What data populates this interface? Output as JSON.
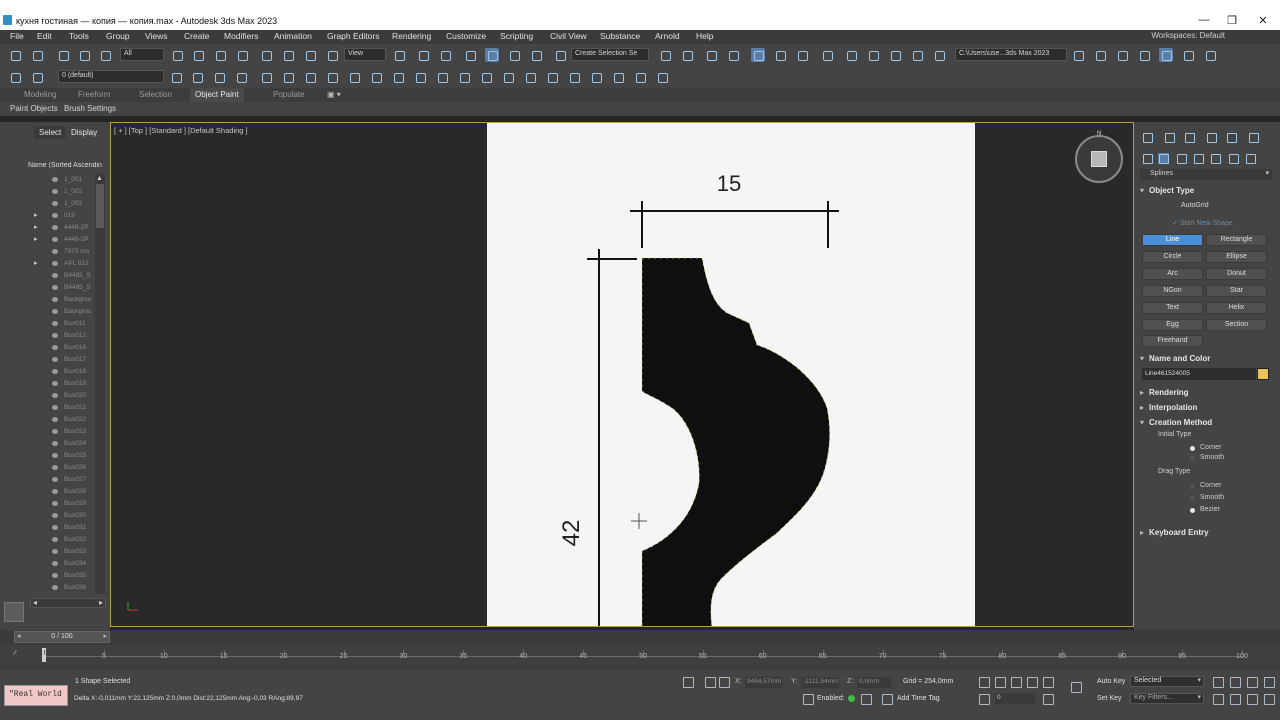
{
  "window": {
    "title": "кухня гостиная — копия — копия.max - Autodesk 3ds Max 2023",
    "controls": [
      "—",
      "❐",
      "✕"
    ]
  },
  "menu": {
    "items": [
      "File",
      "Edit",
      "Tools",
      "Group",
      "Views",
      "Create",
      "Modifiers",
      "Animation",
      "Graph Editors",
      "Rendering",
      "Customize",
      "Scripting",
      "Civil View",
      "Substance",
      "Arnold",
      "Help"
    ],
    "workspaces": "Workspaces: Default"
  },
  "toolbar": {
    "selection_filter": "All",
    "view_dropdown": "View",
    "create_selection_set": "Create Selection Se",
    "project_path": "C:\\Users\\use...3ds Max 2023",
    "layer": "0 (default)"
  },
  "ribbon": {
    "tabs": [
      "Modeling",
      "Freeform",
      "Selection",
      "Object Paint",
      "Populate"
    ],
    "active_tab": "Object Paint",
    "sub_items": [
      "Paint Objects",
      "Brush Settings"
    ]
  },
  "scene_explorer": {
    "tabs": [
      "Select",
      "Display"
    ],
    "header": "Name (Sorted Ascendin",
    "items": [
      {
        "name": "1_001",
        "expandable": false
      },
      {
        "name": "1_002",
        "expandable": false
      },
      {
        "name": "1_003",
        "expandable": false
      },
      {
        "name": "019",
        "expandable": true
      },
      {
        "name": "4448-2P",
        "expandable": true
      },
      {
        "name": "4448-2P",
        "expandable": true
      },
      {
        "name": "7973 mo",
        "expandable": false
      },
      {
        "name": "APL 012",
        "expandable": true
      },
      {
        "name": "B4485_S",
        "expandable": false
      },
      {
        "name": "B4485_S",
        "expandable": false
      },
      {
        "name": "Backgrou",
        "expandable": false
      },
      {
        "name": "Backgrou",
        "expandable": false
      },
      {
        "name": "Box011",
        "expandable": false
      },
      {
        "name": "Box012",
        "expandable": false
      },
      {
        "name": "Box016",
        "expandable": false
      },
      {
        "name": "Box017",
        "expandable": false
      },
      {
        "name": "Box018",
        "expandable": false
      },
      {
        "name": "Box019",
        "expandable": false
      },
      {
        "name": "Box020",
        "expandable": false
      },
      {
        "name": "Box021",
        "expandable": false
      },
      {
        "name": "Box022",
        "expandable": false
      },
      {
        "name": "Box023",
        "expandable": false
      },
      {
        "name": "Box024",
        "expandable": false
      },
      {
        "name": "Box025",
        "expandable": false
      },
      {
        "name": "Box026",
        "expandable": false
      },
      {
        "name": "Box027",
        "expandable": false
      },
      {
        "name": "Box028",
        "expandable": false
      },
      {
        "name": "Box029",
        "expandable": false
      },
      {
        "name": "Box030",
        "expandable": false
      },
      {
        "name": "Box031",
        "expandable": false
      },
      {
        "name": "Box032",
        "expandable": false
      },
      {
        "name": "Box033",
        "expandable": false
      },
      {
        "name": "Box034",
        "expandable": false
      },
      {
        "name": "Box035",
        "expandable": false
      },
      {
        "name": "Box036",
        "expandable": false
      }
    ]
  },
  "viewport": {
    "label": "[ + ] [Top ] [Standard ] [Default Shading ]",
    "dimension_top": "15",
    "dimension_side": "42",
    "viewcube_north": "N"
  },
  "command_panel": {
    "category_dropdown": "Splines",
    "object_type": {
      "title": "Object Type",
      "autogrid": "AutoGrid",
      "start_new_shape": "Start New Shape",
      "buttons": [
        "Line",
        "Rectangle",
        "Circle",
        "Ellipse",
        "Arc",
        "Donut",
        "NGon",
        "Star",
        "Text",
        "Helix",
        "Egg",
        "Section",
        "Freehand"
      ],
      "active": "Line"
    },
    "name_and_color": {
      "title": "Name and Color",
      "name": "Line461524005",
      "color": "#e8c35a"
    },
    "rendering": "Rendering",
    "interpolation": "Interpolation",
    "creation_method": {
      "title": "Creation Method",
      "initial_type_label": "Initial Type",
      "initial_type_options": [
        "Corner",
        "Smooth"
      ],
      "initial_selected": "Corner",
      "drag_type_label": "Drag Type",
      "drag_type_options": [
        "Corner",
        "Smooth",
        "Bezier"
      ],
      "drag_selected": "Bezier"
    },
    "keyboard_entry": "Keyboard Entry"
  },
  "timeline": {
    "frame_display": "0 / 100",
    "ticks": [
      0,
      5,
      10,
      15,
      20,
      25,
      30,
      35,
      40,
      45,
      50,
      55,
      60,
      65,
      70,
      75,
      80,
      85,
      90,
      95,
      100
    ]
  },
  "status": {
    "maxscript": "\"Real World !",
    "selection": "1 Shape Selected",
    "prompt": "Delta X:-0,011mm  Y:22,125mm  Z:0,0mm  Dist:22,125mm  Ang:-0,03 RAng:89,97",
    "x_label": "X:",
    "x_value": "9454,57mm",
    "y_label": "Y:",
    "y_value": "-2111,54mm",
    "z_label": "Z:",
    "z_value": "0,0mm",
    "grid": "Grid = 254,0mm",
    "enabled_label": "Enabled:",
    "add_time_tag": "Add Time Tag",
    "auto_key": "Auto Key",
    "set_key": "Set Key",
    "selected_dropdown": "Selected",
    "key_filters": "Key Filters...",
    "frame_field": "0"
  }
}
